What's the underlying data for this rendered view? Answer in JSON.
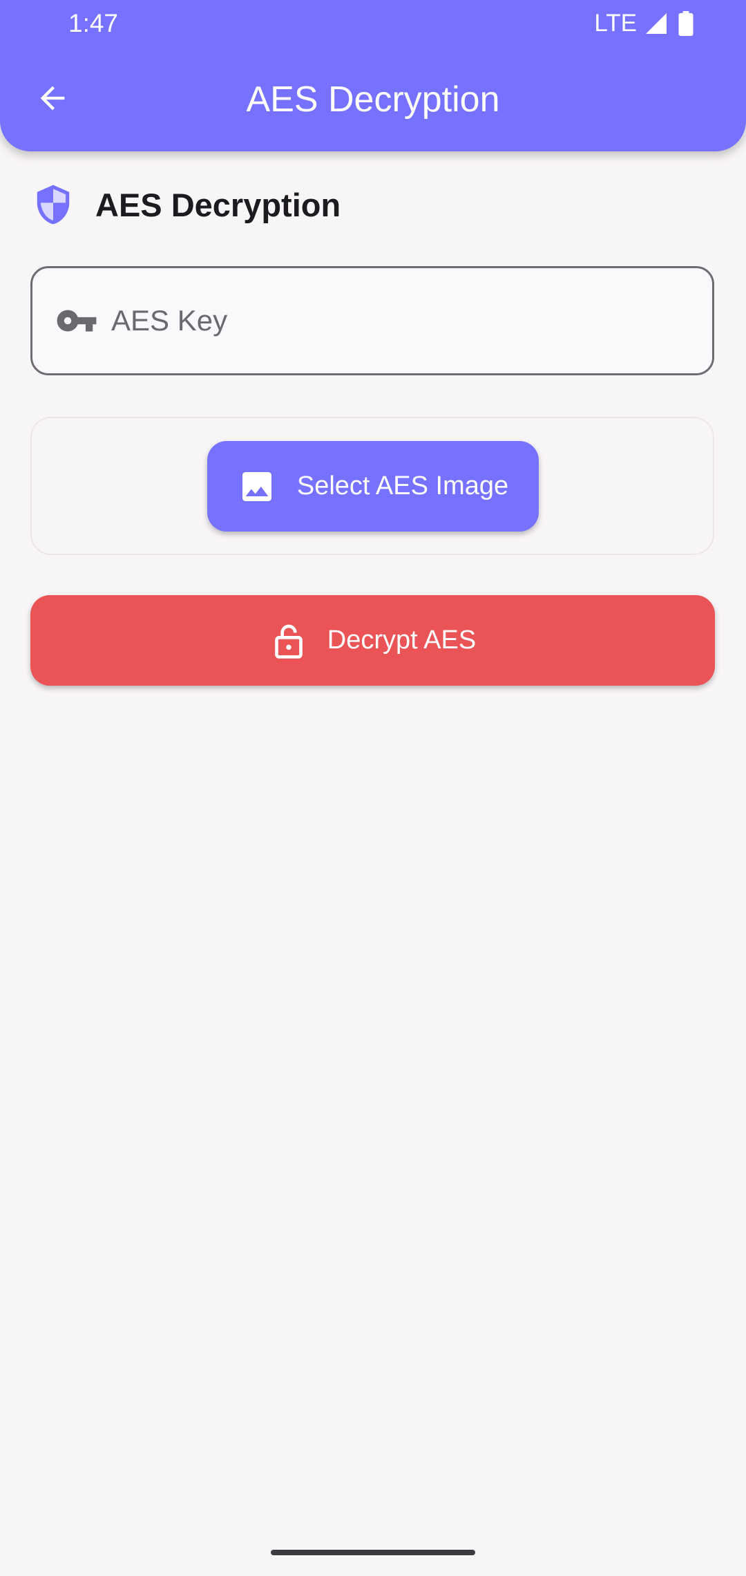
{
  "status_bar": {
    "time": "1:47",
    "network": "LTE",
    "icons": [
      "signal-icon",
      "battery-icon"
    ]
  },
  "app_bar": {
    "title": "AES Decryption",
    "back_icon": "arrow-back-icon"
  },
  "section": {
    "icon": "shield-icon",
    "title": "AES Decryption"
  },
  "key_field": {
    "icon": "key-icon",
    "value": "",
    "placeholder": "AES Key"
  },
  "select_image": {
    "icon": "image-icon",
    "label": "Select AES Image"
  },
  "decrypt": {
    "icon": "unlock-icon",
    "label": "Decrypt AES"
  },
  "colors": {
    "primary": "#7672ff",
    "danger": "#eb5456",
    "background": "#f8f5f7"
  }
}
